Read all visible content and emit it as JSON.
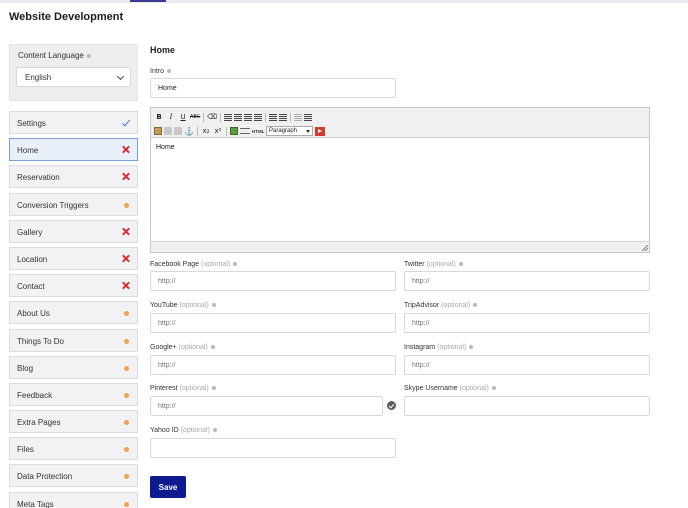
{
  "header": {
    "title": "Website Development"
  },
  "language": {
    "label": "Content Language",
    "selected": "English"
  },
  "sidebar": {
    "items": [
      {
        "label": "Settings",
        "status": "check"
      },
      {
        "label": "Home",
        "status": "cross",
        "active": true
      },
      {
        "label": "Reservation",
        "status": "cross"
      },
      {
        "label": "Conversion Triggers",
        "status": "orange"
      },
      {
        "label": "Gallery",
        "status": "cross"
      },
      {
        "label": "Location",
        "status": "cross"
      },
      {
        "label": "Contact",
        "status": "cross"
      },
      {
        "label": "About Us",
        "status": "orange"
      },
      {
        "label": "Things To Do",
        "status": "orange"
      },
      {
        "label": "Blog",
        "status": "orange"
      },
      {
        "label": "Feedback",
        "status": "orange"
      },
      {
        "label": "Extra Pages",
        "status": "orange"
      },
      {
        "label": "Files",
        "status": "orange"
      },
      {
        "label": "Data Protection",
        "status": "orange"
      },
      {
        "label": "Meta Tags",
        "status": "orange"
      }
    ]
  },
  "main": {
    "section_title": "Home",
    "intro": {
      "label": "Intro",
      "value": "Home"
    },
    "editor": {
      "content": "Home",
      "format_select": "Paragraph",
      "toolbar": {
        "bold": "B",
        "italic": "I",
        "underline": "U",
        "strike": "ABC",
        "html": "HTML",
        "subscript": "x₂",
        "superscript": "x²"
      }
    },
    "optional_text": "(optional)",
    "placeholder": "http://",
    "fields": {
      "facebook": {
        "label": "Facebook Page"
      },
      "twitter": {
        "label": "Twitter"
      },
      "youtube": {
        "label": "YouTube"
      },
      "tripadvisor": {
        "label": "TripAdvisor"
      },
      "googleplus": {
        "label": "Google+"
      },
      "instagram": {
        "label": "Instagram"
      },
      "pinterest": {
        "label": "Pinterest"
      },
      "skype": {
        "label": "Skype Username"
      },
      "yahoo": {
        "label": "Yahoo ID"
      }
    },
    "save_label": "Save"
  },
  "colors": {
    "accent": "#0e1a8f",
    "error": "#d22b3a",
    "warning": "#f0a04b",
    "ok": "#4a7cc9"
  },
  "icons": [
    "chevron-down-icon",
    "check-icon",
    "cross-icon",
    "warning-dot-icon",
    "info-icon",
    "verify-check-icon"
  ]
}
